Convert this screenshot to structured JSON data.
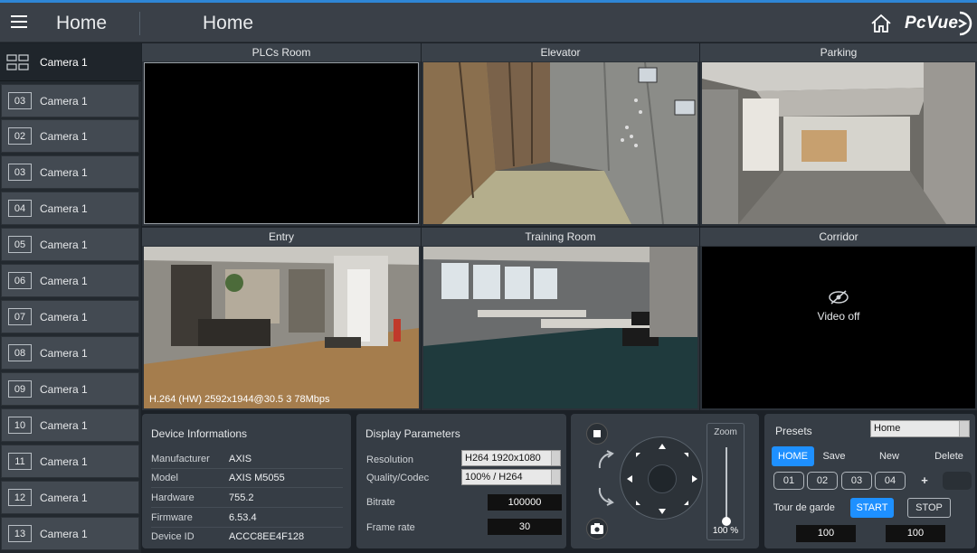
{
  "header": {
    "title_left": "Home",
    "title_center": "Home",
    "logo": "PcVue"
  },
  "sidebar": {
    "first": {
      "label": "Camera 1",
      "icon": "grid-layout-icon"
    },
    "items": [
      {
        "num": "03",
        "label": "Camera 1"
      },
      {
        "num": "02",
        "label": "Camera 1"
      },
      {
        "num": "03",
        "label": "Camera 1"
      },
      {
        "num": "04",
        "label": "Camera 1"
      },
      {
        "num": "05",
        "label": "Camera 1"
      },
      {
        "num": "06",
        "label": "Camera 1"
      },
      {
        "num": "07",
        "label": "Camera 1"
      },
      {
        "num": "08",
        "label": "Camera 1"
      },
      {
        "num": "09",
        "label": "Camera 1"
      },
      {
        "num": "10",
        "label": "Camera 1"
      },
      {
        "num": "11",
        "label": "Camera 1"
      },
      {
        "num": "12",
        "label": "Camera 1"
      },
      {
        "num": "13",
        "label": "Camera 1"
      }
    ]
  },
  "cameras": [
    {
      "title": "PLCs Room"
    },
    {
      "title": "Elevator"
    },
    {
      "title": "Parking"
    },
    {
      "title": "Entry",
      "overlay": "H.264 (HW) 2592x1944@30.5 3 78Mbps"
    },
    {
      "title": "Training Room"
    },
    {
      "title": "Corridor",
      "status": "Video off"
    }
  ],
  "device_info": {
    "title": "Device Informations",
    "rows": [
      {
        "key": "Manufacturer",
        "value": "AXIS"
      },
      {
        "key": "Model",
        "value": "AXIS M5055"
      },
      {
        "key": "Hardware",
        "value": "755.2"
      },
      {
        "key": "Firmware",
        "value": "6.53.4"
      },
      {
        "key": "Device ID",
        "value": "ACCC8EE4F128"
      }
    ]
  },
  "display_params": {
    "title": "Display Parameters",
    "resolution_label": "Resolution",
    "resolution_value": "H264 1920x1080",
    "quality_label": "Quality/Codec",
    "quality_value": "100%  /  H264",
    "bitrate_label": "Bitrate",
    "bitrate_value": "100000",
    "framerate_label": "Frame rate",
    "framerate_value": "30"
  },
  "ptz": {
    "zoom_label": "Zoom",
    "zoom_value": "100 %",
    "zoom_level": 1.0
  },
  "presets": {
    "title": "Presets",
    "selected": "Home",
    "home": "HOME",
    "save": "Save",
    "new": "New",
    "delete": "Delete",
    "slots": [
      "01",
      "02",
      "03",
      "04"
    ],
    "add": "+",
    "tour_label": "Tour de garde",
    "start": "START",
    "stop": "STOP",
    "value1": "100",
    "value2": "100"
  },
  "colors": {
    "accent": "#1e90ff",
    "topline": "#2e86d6"
  }
}
